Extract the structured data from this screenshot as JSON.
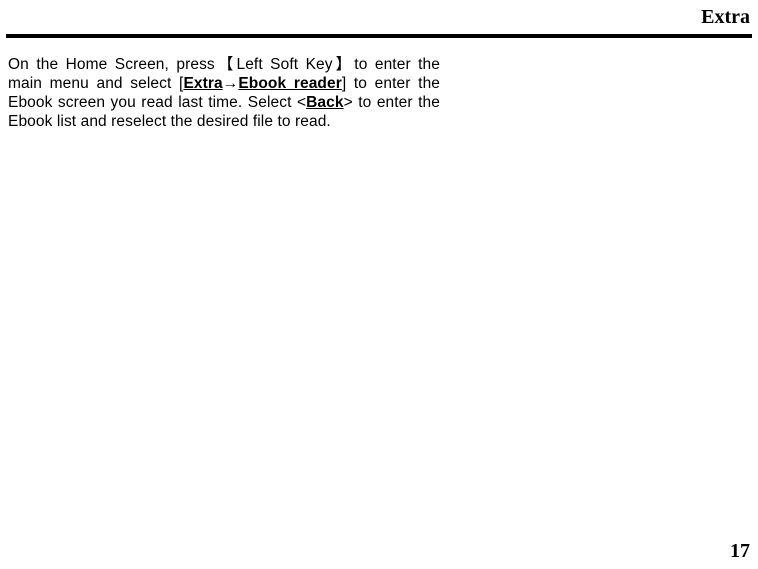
{
  "header": {
    "title": "Extra"
  },
  "body": {
    "p1_seg1": "On the Home Screen, press",
    "p1_bracket_open": "【",
    "p1_key": "Left Soft Key",
    "p1_bracket_close": "】",
    "p1_seg2": "to enter the main menu and select [",
    "p1_extra": "Extra",
    "p1_arrow": "→",
    "p1_ebook": "Ebook reader",
    "p1_seg3": "] to enter the Ebook screen you read last time. Select <",
    "p1_back": "Back",
    "p1_seg4": "> to enter the Ebook list and reselect the desired file to read."
  },
  "footer": {
    "page_number": "17"
  }
}
